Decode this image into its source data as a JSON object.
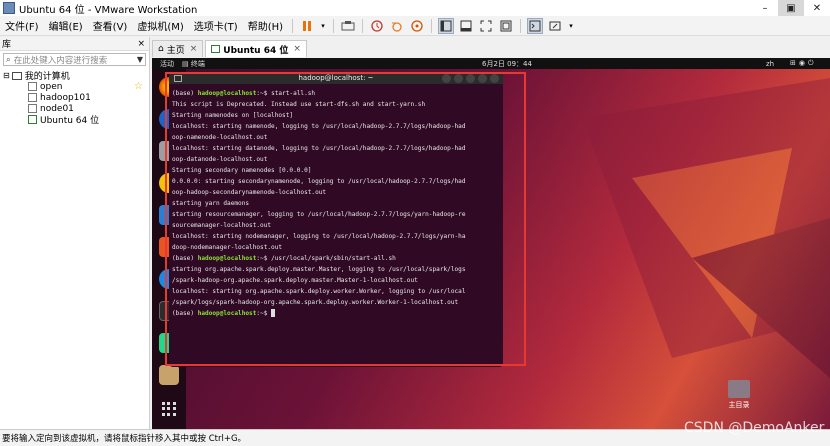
{
  "window": {
    "title": "Ubuntu 64 位 - VMware Workstation"
  },
  "menu": [
    "文件(F)",
    "编辑(E)",
    "查看(V)",
    "虚拟机(M)",
    "选项卡(T)",
    "帮助(H)"
  ],
  "library": {
    "header": "库",
    "close": "×",
    "search_placeholder": "在此处键入内容进行搜索",
    "root": "我的计算机",
    "items": [
      "open",
      "hadoop101",
      "node01",
      "Ubuntu 64 位"
    ]
  },
  "tabs": [
    {
      "label": "主页",
      "close": "×"
    },
    {
      "label": "Ubuntu 64 位",
      "close": "×"
    }
  ],
  "guest": {
    "activities": "活动",
    "terminal_label": "终端",
    "clock": "6月2日 09：44",
    "lang": "zh",
    "terminal_title": "hadoop@localhost: ~",
    "home_label": "主目录"
  },
  "terminal_lines": [
    "(base) hadoop@localhost:~$ start-all.sh",
    "This script is Deprecated. Instead use start-dfs.sh and start-yarn.sh",
    "Starting namenodes on [localhost]",
    "localhost: starting namenode, logging to /usr/local/hadoop-2.7.7/logs/hadoop-had",
    "oop-namenode-localhost.out",
    "localhost: starting datanode, logging to /usr/local/hadoop-2.7.7/logs/hadoop-had",
    "oop-datanode-localhost.out",
    "Starting secondary namenodes [0.0.0.0]",
    "0.0.0.0: starting secondarynamenode, logging to /usr/local/hadoop-2.7.7/logs/had",
    "oop-hadoop-secondarynamenode-localhost.out",
    "starting yarn daemons",
    "starting resourcemanager, logging to /usr/local/hadoop-2.7.7/logs/yarn-hadoop-re",
    "sourcemanager-localhost.out",
    "localhost: starting nodemanager, logging to /usr/local/hadoop-2.7.7/logs/yarn-ha",
    "doop-nodemanager-localhost.out",
    "(base) hadoop@localhost:~$ /usr/local/spark/sbin/start-all.sh",
    "starting org.apache.spark.deploy.master.Master, logging to /usr/local/spark/logs",
    "/spark-hadoop-org.apache.spark.deploy.master.Master-1-localhost.out",
    "localhost: starting org.apache.spark.deploy.worker.Worker, logging to /usr/local",
    "/spark/logs/spark-hadoop-org.apache.spark.deploy.worker.Worker-1-localhost.out",
    "(base) hadoop@localhost:~$ "
  ],
  "status": "要将输入定向到该虚拟机，请将鼠标指针移入其中或按 Ctrl+G。",
  "watermark": "CSDN @DemoAnker",
  "colors": {
    "highlight": "#e53935",
    "terminal_bg": "#300a24",
    "prompt_user": "#8ae234"
  }
}
